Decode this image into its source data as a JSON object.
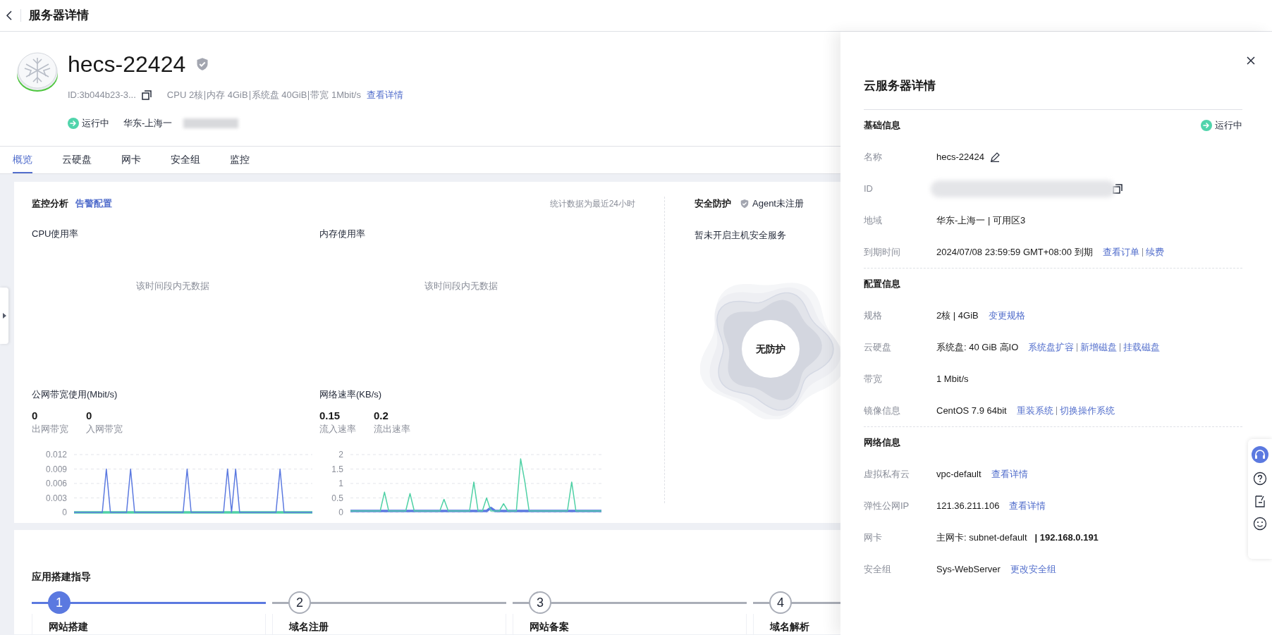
{
  "top_bar": {
    "title": "服务器详情"
  },
  "server": {
    "name": "hecs-22424",
    "id": "ID:3b044b23-3...",
    "specs": [
      "CPU 2核",
      "内存 4GiB",
      "系统盘 40GiB",
      "带宽 1Mbit/s"
    ],
    "details_link": "查看详情",
    "status": "运行中",
    "region": "华东-上海一"
  },
  "tabs": [
    {
      "label": "概览",
      "selected": true
    },
    {
      "label": "云硬盘",
      "selected": false
    },
    {
      "label": "网卡",
      "selected": false
    },
    {
      "label": "安全组",
      "selected": false
    },
    {
      "label": "监控",
      "selected": false
    }
  ],
  "monitoring": {
    "title": "监控分析",
    "alarm_link": "告警配置",
    "period_note": "统计数据为最近24小时",
    "cpu": {
      "title": "CPU使用率",
      "empty_text": "该时间段内无数据"
    },
    "memory": {
      "title": "内存使用率",
      "empty_text": "该时间段内无数据"
    },
    "bandwidth": {
      "title": "公网带宽使用(Mbit/s)",
      "stats": [
        {
          "value": "0",
          "label": "出网带宽"
        },
        {
          "value": "0",
          "label": "入网带宽"
        }
      ],
      "chart_data": {
        "type": "line",
        "grid": true,
        "ylim": [
          0,
          0.012
        ],
        "yticks": [
          0,
          0.003,
          0.006,
          0.009,
          0.012
        ],
        "series": [
          {
            "color": "#5b79e0",
            "values": [
              0,
              0,
              0,
              0,
              0,
              0,
              0,
              0,
              0.009,
              0,
              0,
              0,
              0,
              0,
              0.009,
              0,
              0,
              0,
              0,
              0,
              0,
              0,
              0,
              0,
              0,
              0,
              0,
              0,
              0.009,
              0,
              0,
              0,
              0,
              0,
              0,
              0,
              0,
              0,
              0.009,
              0,
              0.009,
              0,
              0,
              0,
              0,
              0,
              0,
              0,
              0,
              0,
              0,
              0.009,
              0,
              0,
              0,
              0,
              0,
              0,
              0,
              0
            ]
          },
          {
            "color": "#4fd1a5",
            "values": [
              0,
              0,
              0,
              0,
              0,
              0,
              0,
              0,
              0,
              0,
              0,
              0,
              0,
              0,
              0,
              0,
              0,
              0,
              0,
              0,
              0,
              0,
              0,
              0,
              0,
              0,
              0,
              0,
              0,
              0,
              0,
              0,
              0,
              0,
              0,
              0,
              0,
              0,
              0,
              0,
              0,
              0,
              0,
              0,
              0,
              0,
              0,
              0,
              0,
              0,
              0,
              0,
              0,
              0,
              0,
              0,
              0,
              0,
              0,
              0
            ]
          }
        ]
      }
    },
    "network": {
      "title": "网络速率(KB/s)",
      "stats": [
        {
          "value": "0.15",
          "label": "流入速率"
        },
        {
          "value": "0.2",
          "label": "流出速率"
        }
      ],
      "chart_data": {
        "type": "line",
        "grid": true,
        "ylim": [
          0,
          2
        ],
        "yticks": [
          0,
          0.5,
          1,
          1.5,
          2
        ],
        "series": [
          {
            "color": "#4fd1a5",
            "values": [
              0.05,
              0.05,
              0.05,
              0.05,
              0.05,
              0.05,
              0.05,
              0.05,
              0.7,
              0.05,
              0.05,
              0.05,
              0.05,
              0.05,
              0.65,
              0.05,
              0.05,
              0.05,
              0.05,
              0.05,
              0.05,
              0.05,
              0.45,
              0.05,
              0.05,
              0.05,
              0.05,
              0.05,
              0.05,
              1.05,
              0.05,
              0.05,
              0.5,
              0.05,
              0.05,
              0.05,
              0.3,
              0.05,
              0.05,
              0.05,
              1.85,
              1.05,
              0.05,
              0.05,
              0.05,
              0.05,
              0.05,
              0.05,
              0.05,
              0.05,
              0.05,
              0.05,
              1.05,
              0.05,
              0.05,
              0.05,
              0.05,
              0.05,
              0.05,
              0.05
            ]
          },
          {
            "color": "#5b79e0",
            "values": [
              0.05,
              0.05,
              0.05,
              0.05,
              0.05,
              0.05,
              0.05,
              0.05,
              0.05,
              0.05,
              0.05,
              0.05,
              0.05,
              0.05,
              0.05,
              0.05,
              0.05,
              0.05,
              0.05,
              0.05,
              0.05,
              0.05,
              0.05,
              0.05,
              0.05,
              0.05,
              0.05,
              0.05,
              0.05,
              0.05,
              0.05,
              0.05,
              0.05,
              0.15,
              0.05,
              0.05,
              0.05,
              0.05,
              0.05,
              0.05,
              0.05,
              0.05,
              0.05,
              0.05,
              0.05,
              0.05,
              0.05,
              0.05,
              0.05,
              0.05,
              0.05,
              0.05,
              0.05,
              0.05,
              0.05,
              0.05,
              0.05,
              0.05,
              0.05,
              0.05
            ]
          }
        ]
      }
    }
  },
  "security": {
    "title": "安全防护",
    "agent_status": "Agent未注册",
    "message": "暂未开启主机安全服务",
    "badge": "无防护"
  },
  "guide": {
    "title": "应用搭建指导",
    "steps": [
      {
        "number": "1",
        "title": "网站搭建",
        "selected": true
      },
      {
        "number": "2",
        "title": "域名注册",
        "selected": false
      },
      {
        "number": "3",
        "title": "网站备案",
        "selected": false
      },
      {
        "number": "4",
        "title": "域名解析",
        "selected": false
      }
    ]
  },
  "drawer": {
    "title": "云服务器详情",
    "sections": [
      {
        "title": "基础信息",
        "status": "运行中",
        "rows": [
          {
            "label": "名称",
            "kind": "editable",
            "value": "hecs-22424"
          },
          {
            "label": "ID",
            "kind": "redacted"
          },
          {
            "label": "地域",
            "kind": "text",
            "value": "华东-上海一 | 可用区3"
          },
          {
            "label": "到期时间",
            "kind": "text",
            "value": "2024/07/08 23:59:59 GMT+08:00 到期",
            "links": [
              "查看订单",
              "续费"
            ]
          }
        ]
      },
      {
        "title": "配置信息",
        "rows": [
          {
            "label": "规格",
            "kind": "text",
            "value": "2核 | 4GiB",
            "links": [
              "变更规格"
            ]
          },
          {
            "label": "云硬盘",
            "kind": "text",
            "value": "系统盘: 40 GiB 高IO",
            "links": [
              "系统盘扩容",
              "新增磁盘",
              "挂载磁盘"
            ]
          },
          {
            "label": "带宽",
            "kind": "text",
            "value": "1 Mbit/s"
          },
          {
            "label": "镜像信息",
            "kind": "text",
            "value": "CentOS 7.9 64bit",
            "links": [
              "重装系统",
              "切换操作系统"
            ]
          }
        ]
      },
      {
        "title": "网络信息",
        "rows": [
          {
            "label": "虚拟私有云",
            "kind": "text",
            "value": "vpc-default",
            "links": [
              "查看详情"
            ]
          },
          {
            "label": "弹性公网IP",
            "kind": "text",
            "value": "121.36.211.106",
            "links": [
              "查看详情"
            ]
          },
          {
            "label": "网卡",
            "kind": "text",
            "value": "主网卡: subnet-default   **| 192.168.0.191**"
          },
          {
            "label": "安全组",
            "kind": "text",
            "value": "Sys-WebServer",
            "links": [
              "更改安全组"
            ]
          }
        ]
      }
    ]
  }
}
